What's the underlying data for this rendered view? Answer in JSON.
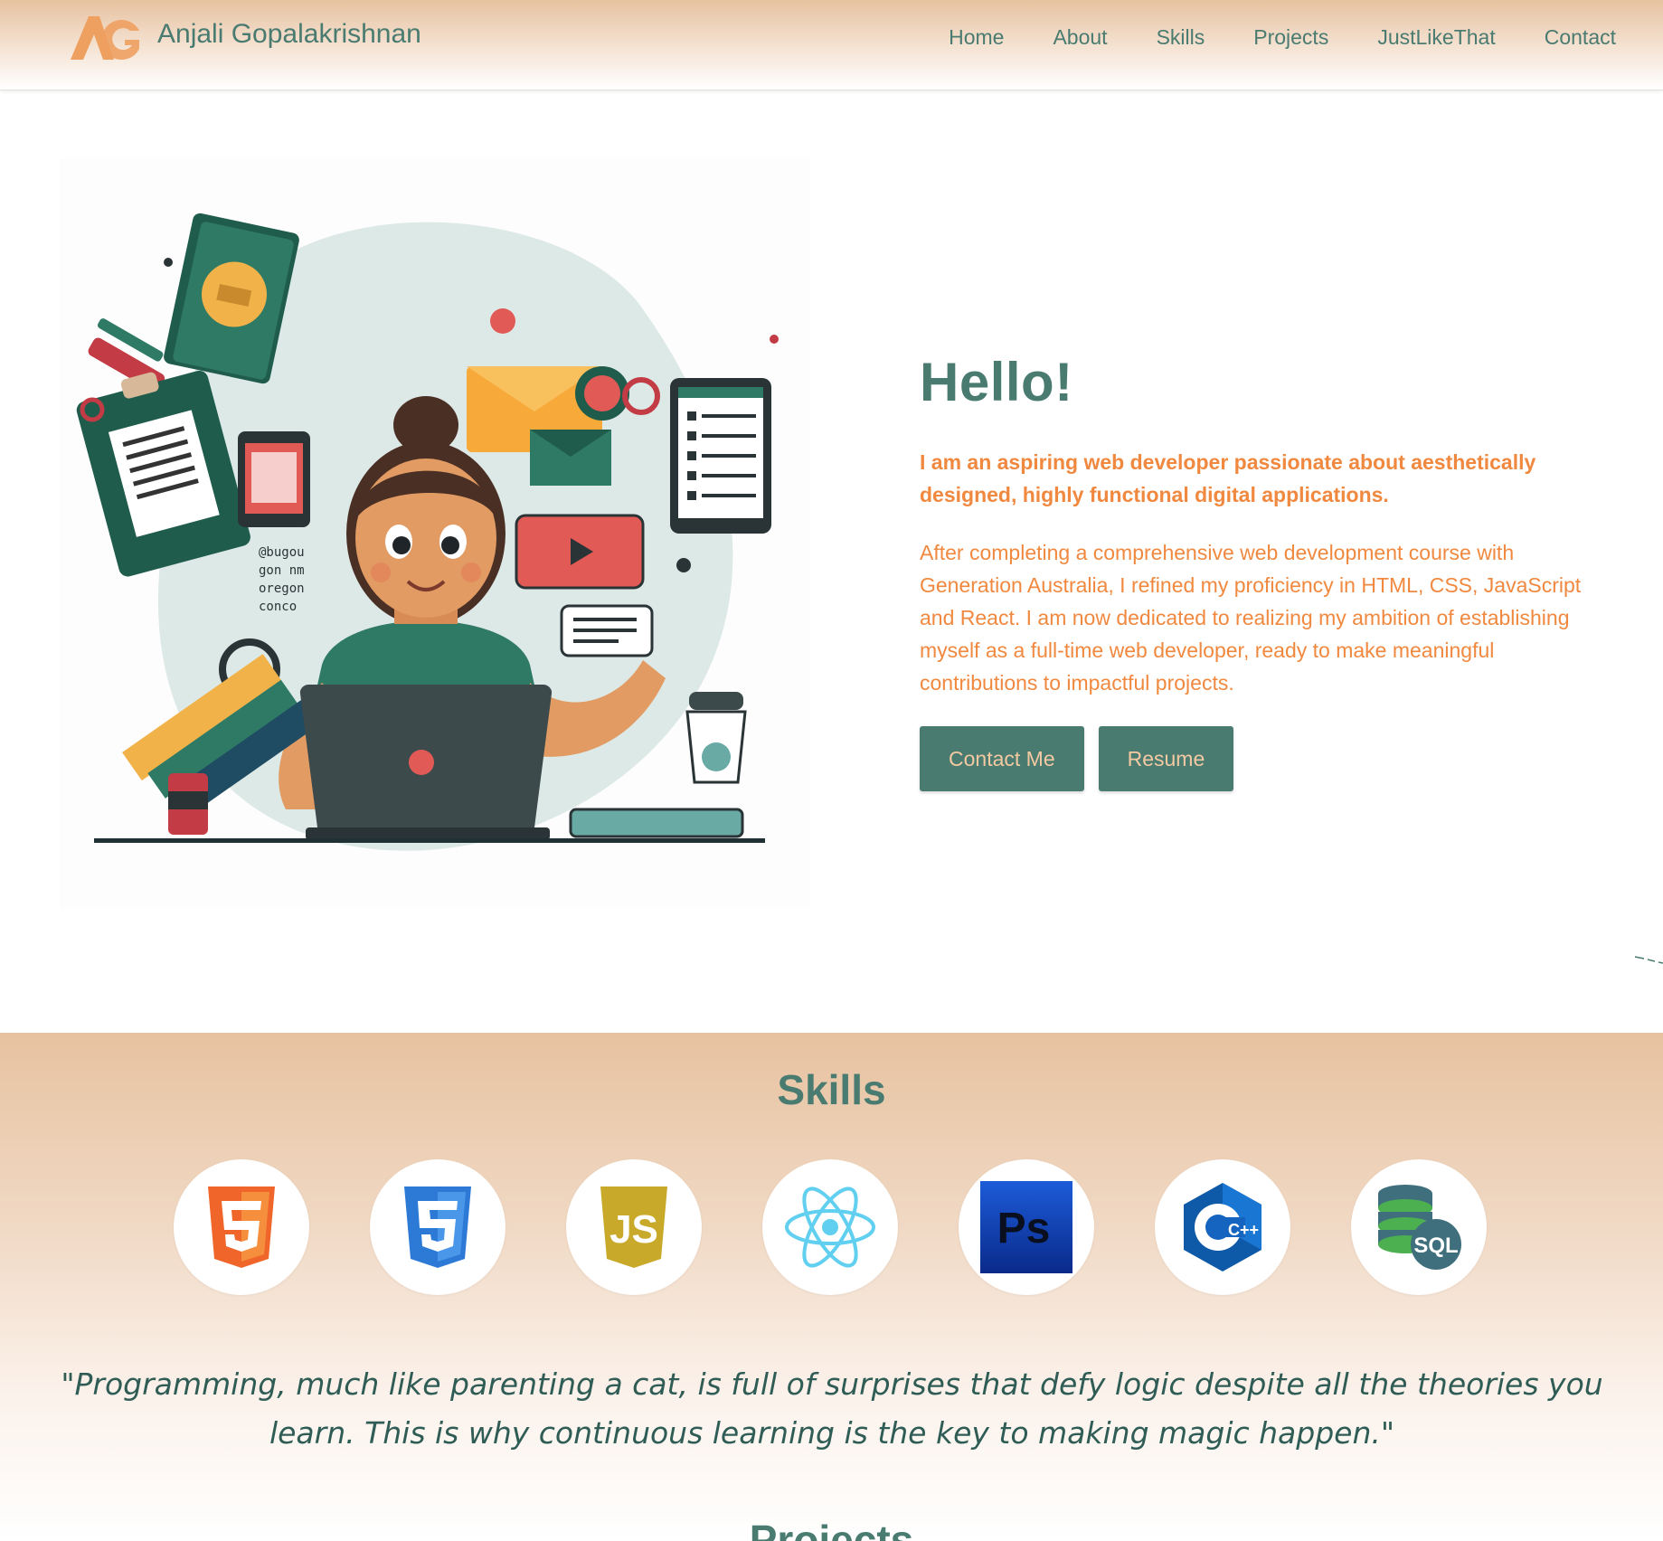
{
  "header": {
    "logo_text": "AG",
    "brand_name": "Anjali Gopalakrishnan",
    "nav": [
      "Home",
      "About",
      "Skills",
      "Projects",
      "JustLikeThat",
      "Contact"
    ]
  },
  "hero": {
    "title": "Hello!",
    "lead": "I am an aspiring web developer passionate about aesthetically designed, highly functional digital applications.",
    "body": "After completing a comprehensive web development course with Generation Australia, I refined my proficiency in HTML, CSS, JavaScript and React. I am now dedicated to realizing my ambition of establishing myself as a full-time web developer, ready to make meaningful contributions to impactful projects.",
    "buttons": {
      "contact": "Contact Me",
      "resume": "Resume"
    },
    "illustration": "woman-with-laptop-illustration"
  },
  "skills": {
    "title": "Skills",
    "icons": [
      "html5-icon",
      "css3-icon",
      "javascript-icon",
      "react-icon",
      "photoshop-icon",
      "cplusplus-icon",
      "sql-database-icon"
    ],
    "icon_text": {
      "js": "JS",
      "ps": "Ps",
      "cpp": "C++",
      "sql": "SQL"
    }
  },
  "quote": "\"Programming, much like parenting a cat, is full of surprises that defy logic despite all the theories you learn. This is why continuous learning is the key to making magic happen.\"",
  "next_section_title": "Projects",
  "colors": {
    "teal": "#4a7b70",
    "orange": "#f0893f",
    "peach": "#e7c2a0",
    "button_text": "#f3c9a2"
  }
}
